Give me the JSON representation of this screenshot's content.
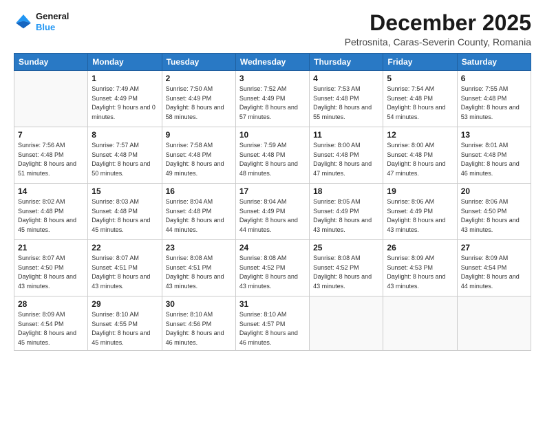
{
  "logo": {
    "line1": "General",
    "line2": "Blue"
  },
  "title": "December 2025",
  "subtitle": "Petrosnita, Caras-Severin County, Romania",
  "weekdays": [
    "Sunday",
    "Monday",
    "Tuesday",
    "Wednesday",
    "Thursday",
    "Friday",
    "Saturday"
  ],
  "weeks": [
    [
      {
        "day": "",
        "sunrise": "",
        "sunset": "",
        "daylight": ""
      },
      {
        "day": "1",
        "sunrise": "Sunrise: 7:49 AM",
        "sunset": "Sunset: 4:49 PM",
        "daylight": "Daylight: 9 hours and 0 minutes."
      },
      {
        "day": "2",
        "sunrise": "Sunrise: 7:50 AM",
        "sunset": "Sunset: 4:49 PM",
        "daylight": "Daylight: 8 hours and 58 minutes."
      },
      {
        "day": "3",
        "sunrise": "Sunrise: 7:52 AM",
        "sunset": "Sunset: 4:49 PM",
        "daylight": "Daylight: 8 hours and 57 minutes."
      },
      {
        "day": "4",
        "sunrise": "Sunrise: 7:53 AM",
        "sunset": "Sunset: 4:48 PM",
        "daylight": "Daylight: 8 hours and 55 minutes."
      },
      {
        "day": "5",
        "sunrise": "Sunrise: 7:54 AM",
        "sunset": "Sunset: 4:48 PM",
        "daylight": "Daylight: 8 hours and 54 minutes."
      },
      {
        "day": "6",
        "sunrise": "Sunrise: 7:55 AM",
        "sunset": "Sunset: 4:48 PM",
        "daylight": "Daylight: 8 hours and 53 minutes."
      }
    ],
    [
      {
        "day": "7",
        "sunrise": "Sunrise: 7:56 AM",
        "sunset": "Sunset: 4:48 PM",
        "daylight": "Daylight: 8 hours and 51 minutes."
      },
      {
        "day": "8",
        "sunrise": "Sunrise: 7:57 AM",
        "sunset": "Sunset: 4:48 PM",
        "daylight": "Daylight: 8 hours and 50 minutes."
      },
      {
        "day": "9",
        "sunrise": "Sunrise: 7:58 AM",
        "sunset": "Sunset: 4:48 PM",
        "daylight": "Daylight: 8 hours and 49 minutes."
      },
      {
        "day": "10",
        "sunrise": "Sunrise: 7:59 AM",
        "sunset": "Sunset: 4:48 PM",
        "daylight": "Daylight: 8 hours and 48 minutes."
      },
      {
        "day": "11",
        "sunrise": "Sunrise: 8:00 AM",
        "sunset": "Sunset: 4:48 PM",
        "daylight": "Daylight: 8 hours and 47 minutes."
      },
      {
        "day": "12",
        "sunrise": "Sunrise: 8:00 AM",
        "sunset": "Sunset: 4:48 PM",
        "daylight": "Daylight: 8 hours and 47 minutes."
      },
      {
        "day": "13",
        "sunrise": "Sunrise: 8:01 AM",
        "sunset": "Sunset: 4:48 PM",
        "daylight": "Daylight: 8 hours and 46 minutes."
      }
    ],
    [
      {
        "day": "14",
        "sunrise": "Sunrise: 8:02 AM",
        "sunset": "Sunset: 4:48 PM",
        "daylight": "Daylight: 8 hours and 45 minutes."
      },
      {
        "day": "15",
        "sunrise": "Sunrise: 8:03 AM",
        "sunset": "Sunset: 4:48 PM",
        "daylight": "Daylight: 8 hours and 45 minutes."
      },
      {
        "day": "16",
        "sunrise": "Sunrise: 8:04 AM",
        "sunset": "Sunset: 4:48 PM",
        "daylight": "Daylight: 8 hours and 44 minutes."
      },
      {
        "day": "17",
        "sunrise": "Sunrise: 8:04 AM",
        "sunset": "Sunset: 4:49 PM",
        "daylight": "Daylight: 8 hours and 44 minutes."
      },
      {
        "day": "18",
        "sunrise": "Sunrise: 8:05 AM",
        "sunset": "Sunset: 4:49 PM",
        "daylight": "Daylight: 8 hours and 43 minutes."
      },
      {
        "day": "19",
        "sunrise": "Sunrise: 8:06 AM",
        "sunset": "Sunset: 4:49 PM",
        "daylight": "Daylight: 8 hours and 43 minutes."
      },
      {
        "day": "20",
        "sunrise": "Sunrise: 8:06 AM",
        "sunset": "Sunset: 4:50 PM",
        "daylight": "Daylight: 8 hours and 43 minutes."
      }
    ],
    [
      {
        "day": "21",
        "sunrise": "Sunrise: 8:07 AM",
        "sunset": "Sunset: 4:50 PM",
        "daylight": "Daylight: 8 hours and 43 minutes."
      },
      {
        "day": "22",
        "sunrise": "Sunrise: 8:07 AM",
        "sunset": "Sunset: 4:51 PM",
        "daylight": "Daylight: 8 hours and 43 minutes."
      },
      {
        "day": "23",
        "sunrise": "Sunrise: 8:08 AM",
        "sunset": "Sunset: 4:51 PM",
        "daylight": "Daylight: 8 hours and 43 minutes."
      },
      {
        "day": "24",
        "sunrise": "Sunrise: 8:08 AM",
        "sunset": "Sunset: 4:52 PM",
        "daylight": "Daylight: 8 hours and 43 minutes."
      },
      {
        "day": "25",
        "sunrise": "Sunrise: 8:08 AM",
        "sunset": "Sunset: 4:52 PM",
        "daylight": "Daylight: 8 hours and 43 minutes."
      },
      {
        "day": "26",
        "sunrise": "Sunrise: 8:09 AM",
        "sunset": "Sunset: 4:53 PM",
        "daylight": "Daylight: 8 hours and 43 minutes."
      },
      {
        "day": "27",
        "sunrise": "Sunrise: 8:09 AM",
        "sunset": "Sunset: 4:54 PM",
        "daylight": "Daylight: 8 hours and 44 minutes."
      }
    ],
    [
      {
        "day": "28",
        "sunrise": "Sunrise: 8:09 AM",
        "sunset": "Sunset: 4:54 PM",
        "daylight": "Daylight: 8 hours and 45 minutes."
      },
      {
        "day": "29",
        "sunrise": "Sunrise: 8:10 AM",
        "sunset": "Sunset: 4:55 PM",
        "daylight": "Daylight: 8 hours and 45 minutes."
      },
      {
        "day": "30",
        "sunrise": "Sunrise: 8:10 AM",
        "sunset": "Sunset: 4:56 PM",
        "daylight": "Daylight: 8 hours and 46 minutes."
      },
      {
        "day": "31",
        "sunrise": "Sunrise: 8:10 AM",
        "sunset": "Sunset: 4:57 PM",
        "daylight": "Daylight: 8 hours and 46 minutes."
      },
      {
        "day": "",
        "sunrise": "",
        "sunset": "",
        "daylight": ""
      },
      {
        "day": "",
        "sunrise": "",
        "sunset": "",
        "daylight": ""
      },
      {
        "day": "",
        "sunrise": "",
        "sunset": "",
        "daylight": ""
      }
    ]
  ]
}
